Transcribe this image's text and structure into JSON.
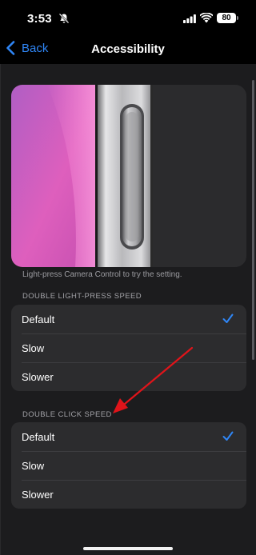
{
  "status": {
    "time": "3:53",
    "battery": "80"
  },
  "nav": {
    "back_label": "Back",
    "title": "Accessibility"
  },
  "hint": "Light-press Camera Control to try the setting.",
  "light_press_section": {
    "header": "DOUBLE LIGHT-PRESS SPEED",
    "options": [
      "Default",
      "Slow",
      "Slower"
    ],
    "selected": "Default"
  },
  "click_section": {
    "header": "DOUBLE CLICK SPEED",
    "options": [
      "Default",
      "Slow",
      "Slower"
    ],
    "selected": "Default"
  },
  "colors": {
    "accent": "#2f86f6",
    "annotation_arrow": "#e0141a"
  },
  "icons": [
    "mute-icon",
    "signal-icon",
    "wifi-icon",
    "battery-icon",
    "back-chevron-icon",
    "checkmark-icon"
  ]
}
